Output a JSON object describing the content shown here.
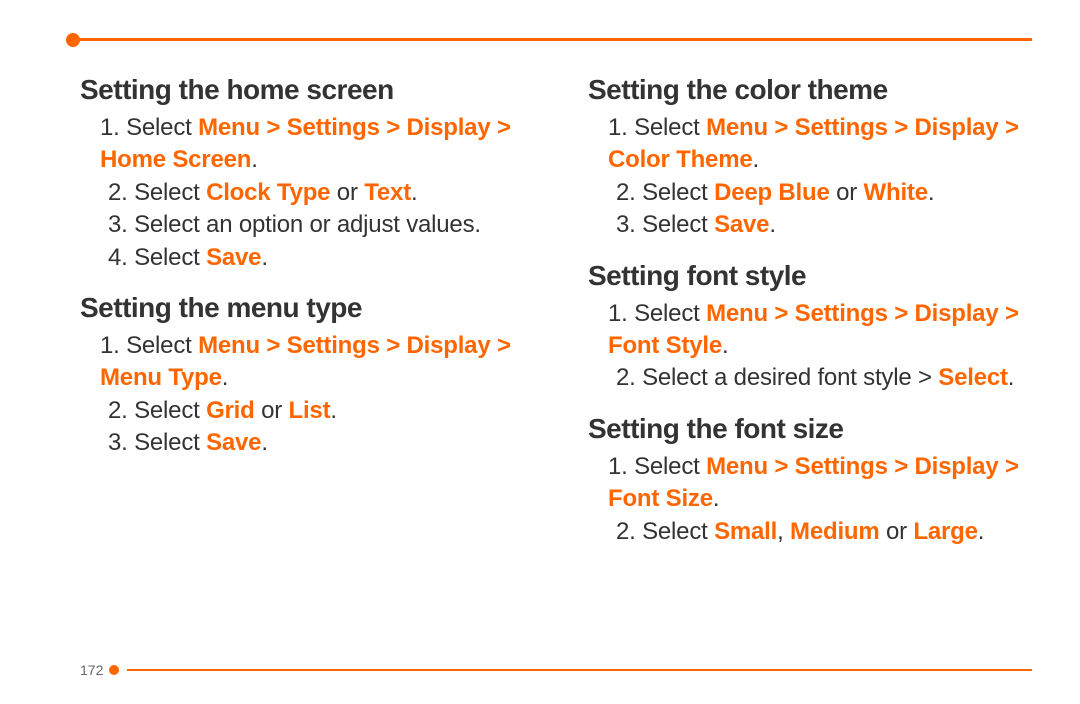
{
  "page_number": "172",
  "left": {
    "sec1": {
      "title": "Setting the home screen",
      "steps": {
        "s1_pre": "1.  Select ",
        "s1_path": "Menu > Settings > Display > Home Screen",
        "s1_post": ".",
        "s2_pre": "2. Select ",
        "s2_a": "Clock Type",
        "s2_mid": " or ",
        "s2_b": "Text",
        "s2_post": ".",
        "s3": "3. Select an option or adjust values.",
        "s4_pre": "4. Select ",
        "s4_a": "Save",
        "s4_post": "."
      }
    },
    "sec2": {
      "title": "Setting the menu type",
      "steps": {
        "s1_pre": "1.  Select ",
        "s1_path": "Menu > Settings > Display > Menu Type",
        "s1_post": ".",
        "s2_pre": "2. Select ",
        "s2_a": "Grid",
        "s2_mid": " or ",
        "s2_b": "List",
        "s2_post": ".",
        "s3_pre": "3. Select ",
        "s3_a": "Save",
        "s3_post": "."
      }
    }
  },
  "right": {
    "sec1": {
      "title": "Setting the color theme",
      "steps": {
        "s1_pre": "1.  Select ",
        "s1_path": "Menu > Settings > Display > Color Theme",
        "s1_post": ".",
        "s2_pre": "2. Select ",
        "s2_a": "Deep Blue",
        "s2_mid": " or ",
        "s2_b": "White",
        "s2_post": ".",
        "s3_pre": "3. Select ",
        "s3_a": "Save",
        "s3_post": "."
      }
    },
    "sec2": {
      "title": "Setting font style",
      "steps": {
        "s1_pre": "1.  Select ",
        "s1_path": "Menu > Settings > Display > Font Style",
        "s1_post": ".",
        "s2_pre": "2. Select a desired font style > ",
        "s2_a": "Select",
        "s2_post": "."
      }
    },
    "sec3": {
      "title": "Setting the font size",
      "steps": {
        "s1_pre": "1.  Select ",
        "s1_path": "Menu > Settings > Display > Font Size",
        "s1_post": ".",
        "s2_pre": "2. Select ",
        "s2_a": "Small",
        "s2_mid1": ", ",
        "s2_b": "Medium",
        "s2_mid2": " or ",
        "s2_c": "Large",
        "s2_post": "."
      }
    }
  }
}
